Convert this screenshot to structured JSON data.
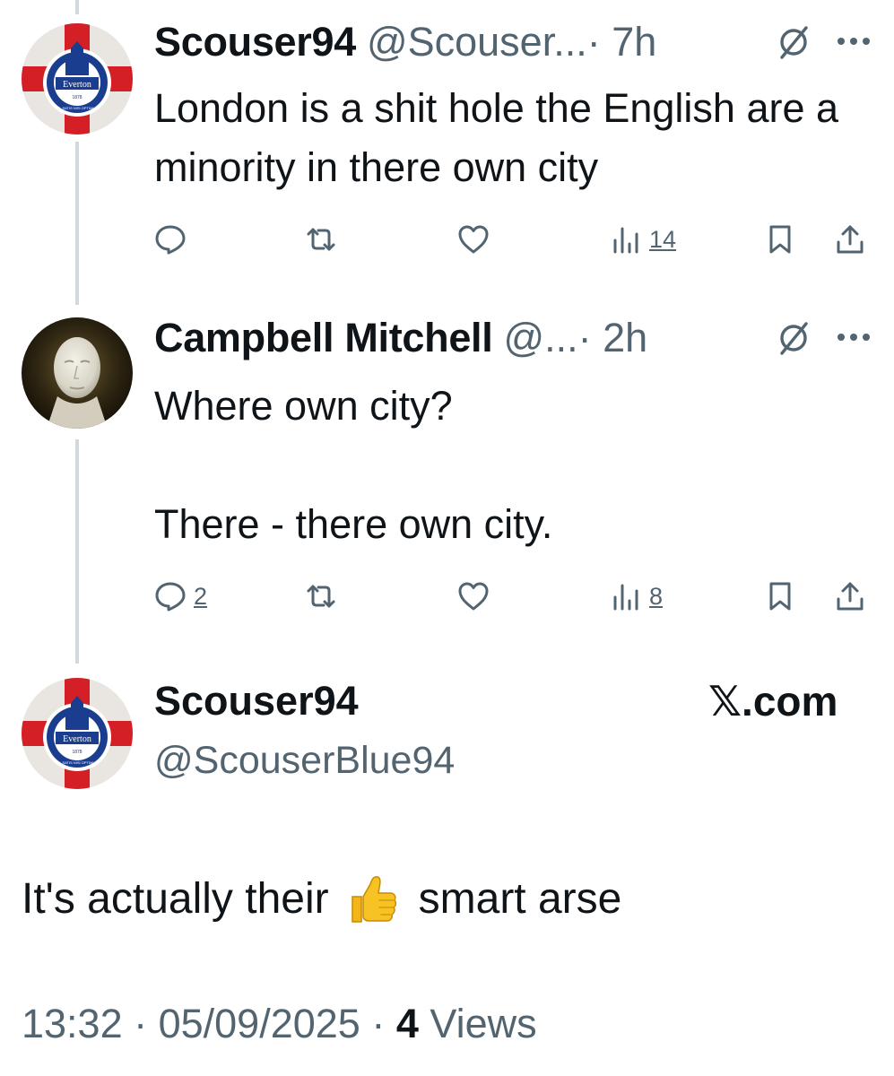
{
  "thread": [
    {
      "display_name": "Scouser94",
      "handle": "@Scouser...",
      "time": "· 7h",
      "text": "London is a shit hole the English are a minority in there own city",
      "actions": {
        "replies": "",
        "reposts": "",
        "likes": "",
        "views": "14"
      },
      "avatar_icon": "everton-crest-avatar"
    },
    {
      "display_name": "Campbell Mitchell",
      "handle": "@...",
      "time": "· 2h",
      "text": "Where own city?\n\nThere - there own city.",
      "actions": {
        "replies": "2",
        "reposts": "",
        "likes": "",
        "views": "8"
      },
      "avatar_icon": "white-face-mask-avatar"
    }
  ],
  "main_tweet": {
    "display_name": "Scouser94",
    "handle": "@ScouserBlue94",
    "source_label": "𝕏.com",
    "text_before": "It's actually their",
    "emoji": "thumbs-up-emoji",
    "text_after": "smart arse",
    "timestamp": "13:32 · 05/09/2025 ·",
    "views_count": "4",
    "views_label": "Views"
  },
  "crest": {
    "label": "Everton",
    "year": "1878",
    "motto": "NIL SATIS NISI OPTIMUM"
  },
  "colors": {
    "text_primary": "#0f1419",
    "text_secondary": "#536471",
    "thread_line": "#cfd9de",
    "st_george_red": "#d51f26",
    "everton_blue": "#1b3d8f",
    "thumb_yellow": "#f7c324"
  }
}
